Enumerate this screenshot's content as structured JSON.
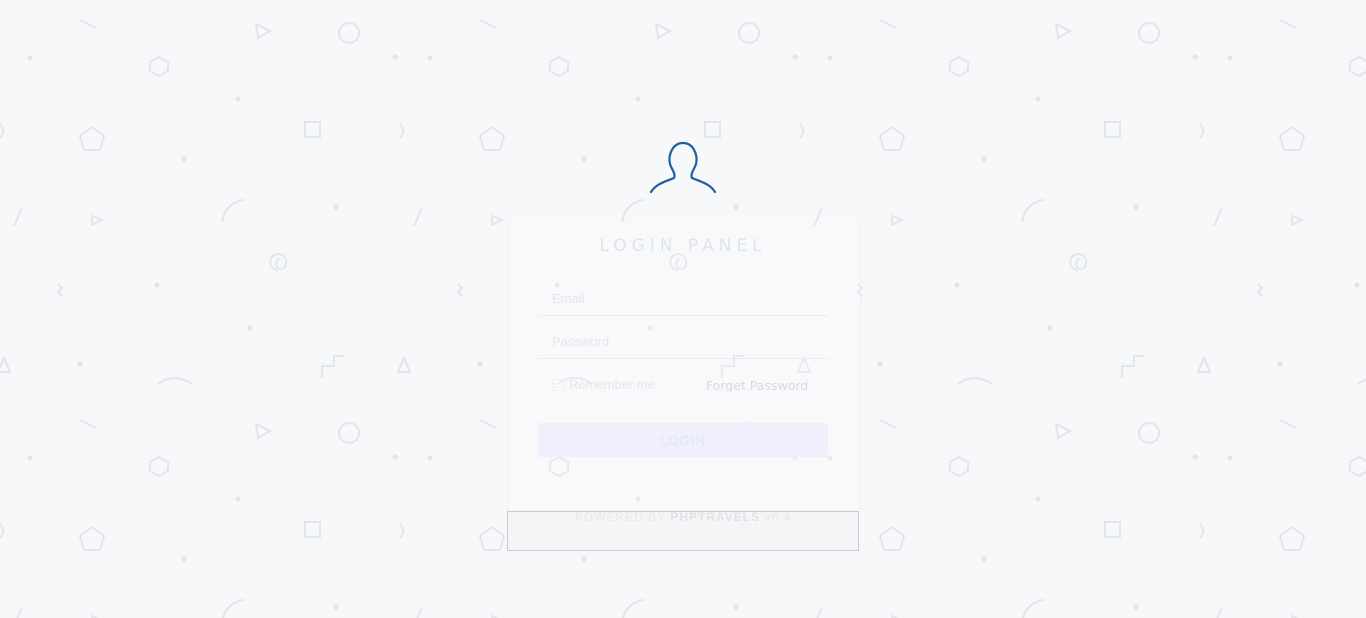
{
  "login": {
    "title": "LOGIN PANEL",
    "email_placeholder": "Email",
    "password_placeholder": "Password",
    "remember_label": "Remember me",
    "forget_label": "Forget Password",
    "login_button": "LOGIN"
  },
  "footer": {
    "powered_prefix": "POWERED BY",
    "brand": "PHPTRAVELS",
    "version": "v6.4"
  },
  "icons": {
    "avatar": "user-outline-icon"
  },
  "colors": {
    "accent": "#1f5fa0",
    "background": "#f7f8fa",
    "pattern": "#e4e7ec"
  }
}
